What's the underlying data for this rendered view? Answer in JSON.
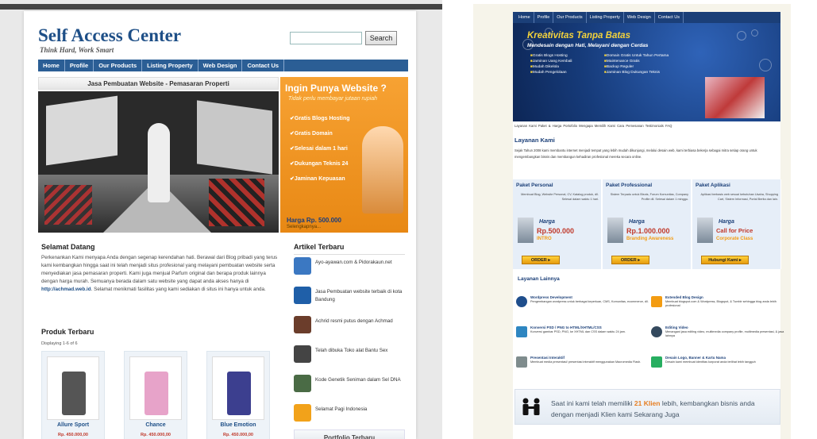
{
  "left": {
    "site_title": "Self Access Center",
    "tagline": "Think Hard, Work Smart",
    "search_button": "Search",
    "nav": [
      "Home",
      "Profile",
      "Our Products",
      "Listing Property",
      "Web Design",
      "Contact Us"
    ],
    "banner_title": "Jasa Pembuatan Website - Pemasaran Properti",
    "promo": {
      "title": "Ingin Punya Website ?",
      "subtitle": "Tidak perlu membayar jutaan rupiah",
      "items": [
        "Gratis Blogs Hosting",
        "Gratis Domain",
        "Selesai dalam 1 hari",
        "Dukungan Teknis 24",
        "Jaminan Kepuasan"
      ],
      "price": "Harga Rp. 500.000",
      "price_sub": "Selengkapnya..."
    },
    "welcome": {
      "title": "Selamat Datang",
      "text": "Perkenankan Kami menyapa Anda dengan segenap kerendahan hati. Berawal dari Blog pribadi yang terus kami kembangkan hingga saat ini telah menjadi situs profesional yang melayani pembuatan website serta menyediakan jasa pemasaran properti. Kami juga menjual Parfum original dan berapa produk lainnya dengan harga murah. Semuanya berada dalam satu website yang dapat anda akses hanya di",
      "link": "http://achmad.web.id",
      "text_after": ". Selamat menikmati fasilitas yang kami sediakan di situs ini hanya untuk anda."
    },
    "products": {
      "title": "Produk Terbaru",
      "subtitle": "Displaying 1-6 of 6",
      "items": [
        {
          "name": "Allure Sport",
          "price": "Rp. 450.000,00",
          "color": "#555555"
        },
        {
          "name": "Chance",
          "price": "Rp. 450.000,00",
          "color": "#e7a3c9"
        },
        {
          "name": "Blue Emotion",
          "price": "Rp. 450.000,00",
          "color": "#3c3f8f"
        }
      ]
    },
    "articles": {
      "title": "Artikel Terbaru",
      "items": [
        {
          "text": "Ayo-ayawan.com & Pidorakaun.net",
          "color": "#3b78c2"
        },
        {
          "text": "Jasa Pembuatan website terbaik di kota Bandung",
          "color": "#1f5fa8"
        },
        {
          "text": "Achrid resmi putus dengan Achmad",
          "color": "#6b3d2b"
        },
        {
          "text": "Telah dibuka Toko alat Bantu Sex",
          "color": "#444444"
        },
        {
          "text": "Kode Genetik Seniman dalam Sel DNA",
          "color": "#4a6b45"
        },
        {
          "text": "Selamat Pagi Indonesia",
          "color": "#f2a21a"
        }
      ],
      "portfolio": "Portfolio Terbaru"
    }
  },
  "right": {
    "nav": [
      "Home",
      "Profile",
      "Our Products",
      "Listing Property",
      "Web Design",
      "Contact Us"
    ],
    "banner": {
      "title": "Kreativitas Tanpa Batas",
      "subtitle": "Mendesain dengan Hati, Melayani dengan Cerdas",
      "col1": [
        "Gratis Blogs Hosting",
        "Jaminan Uang Kembali",
        "Mudah Dikelola",
        "Mudah Pengelolaan"
      ],
      "col2": [
        "Domain Gratis Untuk Tahun Pertama",
        "Maintenance Gratis",
        "Backup Reguler",
        "Jaminan Blog Dukungan Teknis"
      ]
    },
    "subnav": "Layanan Kami  Paket & Harga  Portofolio  Mengapa Memilih Kami  Cara Pemesanan  Testimonials  FAQ",
    "layanan": {
      "title": "Layanan Kami",
      "text": "Sejak Tahun 2008 kami membantu internet menjadi tempat yang lebih mudah dikunjungi, melalui desain web, kami terbiasa bekerja sebagai mitra setiap orang untuk mengembangkan bisnis dan membangun kehadiran profesional mereka secara online."
    },
    "packages": [
      {
        "title": "Paket Personal",
        "desc": "Membuat Blog, Website Personal, CV, Katalog produk, dll. Selesai dalam waktu 1 hari.",
        "harga": "Harga",
        "price": "Rp.500.000",
        "tag": "INTRO",
        "button": "ORDER"
      },
      {
        "title": "Paket Professional",
        "desc": "Sistem Terpadu untuk Bisnis, Forum Komunitas, Company Profile dll. Selesai dalam 1 minggu.",
        "harga": "Harga",
        "price": "Rp.1.000.000",
        "tag": "Branding Awareness",
        "button": "ORDER"
      },
      {
        "title": "Paket Aplikasi",
        "desc": "Aplikasi berbasis web sesuai kebutuhan Usaha, Shopping Cart, Sistem Informasi, Portal Berita dan lain.",
        "harga": "Harga",
        "price": "Call for Price",
        "tag": "Corporate Class",
        "button": "Hubungi Kami"
      }
    ],
    "layanan_lainnya": {
      "title": "Layanan Lainnya",
      "items": [
        {
          "title": "Wordpress Development",
          "desc": "Pengembangan wordpress untuk berbagai keperluan, CMS, Komunitas, ecommerce, dll.",
          "color": "#1f4e8c"
        },
        {
          "title": "Extended Blog Design",
          "desc": "Membuat blogspot.com & Wordpress, Blogspot, & Tumblr sehingga blog anda lebih profesional",
          "color": "#f39c12"
        },
        {
          "title": "Konversi PSD / PNG to HTML/XHTML/CSS",
          "desc": "Konversi gambar PSD, PNG, ke XHTML dan CSS dalam waktu 24 jam.",
          "color": "#2e86c1"
        },
        {
          "title": "Editing Video",
          "desc": "Menangani jasa editing video, multimedia company profile, multimedia presentasi, & jasa lainnya",
          "color": "#34495e"
        },
        {
          "title": "Presentasi Interaktif",
          "desc": "Membuat media presentasi/ presentasi interaktif menggunakan Macromedia Flash.",
          "color": "#7f8c8d"
        },
        {
          "title": "Desain Logo, Banner & Kartu Nama",
          "desc": "Desain kami membuat identitas korporat anda terlihat lebih tangguh",
          "color": "#27ae60"
        }
      ]
    },
    "klien": {
      "pre": "Saat ini kami telah memiliki ",
      "count": "21 Klien",
      "post": " lebih, kembangkan bisnis anda dengan menjadi Klien kami Sekarang Juga"
    }
  }
}
